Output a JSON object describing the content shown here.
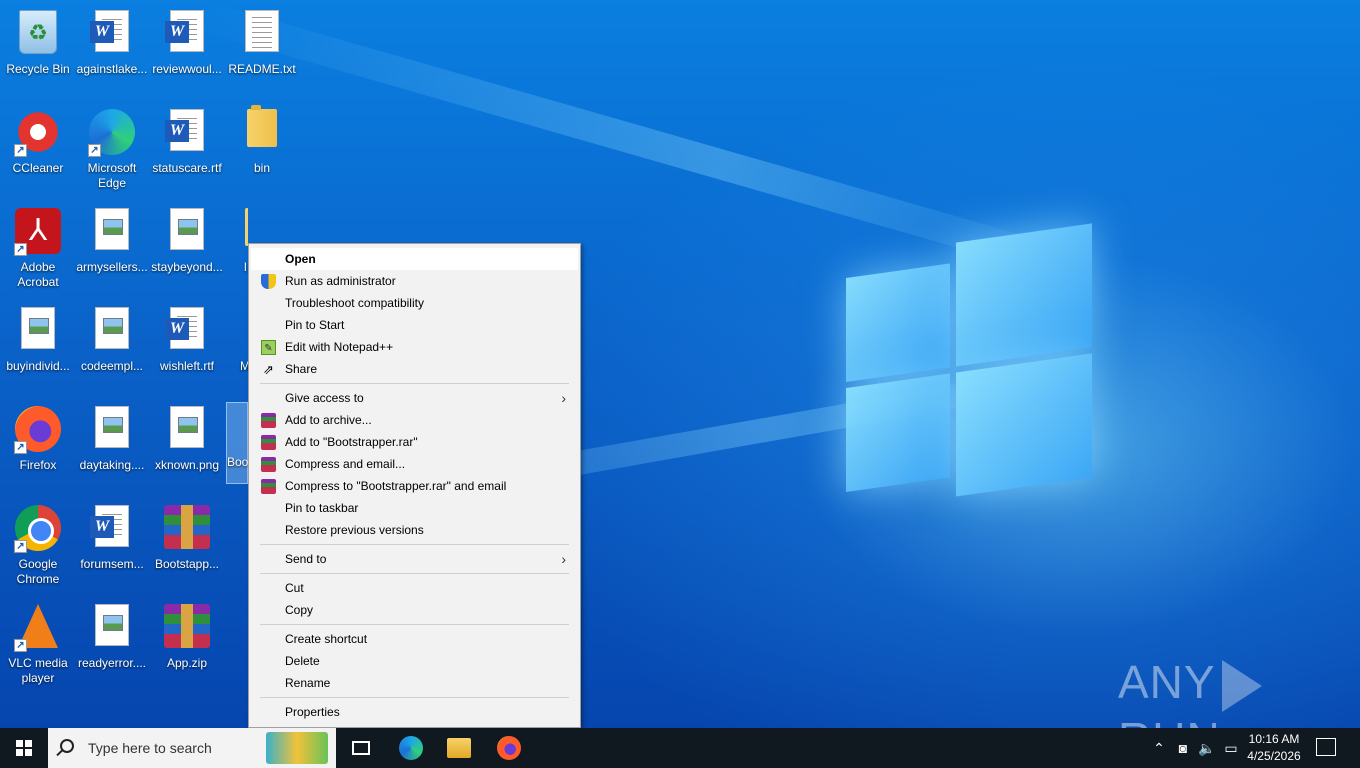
{
  "desktop": {
    "icons": [
      {
        "label": "Recycle Bin",
        "type": "recycle"
      },
      {
        "label": "againstlake...",
        "type": "word"
      },
      {
        "label": "reviewwoul...",
        "type": "word"
      },
      {
        "label": "README.txt",
        "type": "txt"
      },
      {
        "label": "CCleaner",
        "type": "ccleaner"
      },
      {
        "label": "Microsoft Edge",
        "type": "edge"
      },
      {
        "label": "statuscare.rtf",
        "type": "word"
      },
      {
        "label": "bin",
        "type": "folder"
      },
      {
        "label": "Adobe Acrobat",
        "type": "acrobat"
      },
      {
        "label": "armysellers...",
        "type": "image"
      },
      {
        "label": "staybeyond...",
        "type": "image"
      },
      {
        "label": "buyindivid...",
        "type": "image"
      },
      {
        "label": "codeempl...",
        "type": "image"
      },
      {
        "label": "wishleft.rtf",
        "type": "word"
      },
      {
        "label": "Firefox",
        "type": "firefox"
      },
      {
        "label": "daytaking....",
        "type": "image"
      },
      {
        "label": "xknown.png",
        "type": "image"
      },
      {
        "label": "Google Chrome",
        "type": "chrome"
      },
      {
        "label": "forumsem...",
        "type": "word"
      },
      {
        "label": "Bootstapp...",
        "type": "rar"
      },
      {
        "label": "VLC media player",
        "type": "vlc"
      },
      {
        "label": "readyerror....",
        "type": "image"
      },
      {
        "label": "App.zip",
        "type": "rar"
      }
    ],
    "partial_labels": {
      "folder_row3": "l",
      "row4": "M",
      "selected": "Boo"
    }
  },
  "context_menu": {
    "items": [
      {
        "label": "Open",
        "bold": true,
        "icon": ""
      },
      {
        "label": "Run as administrator",
        "icon": "shield-icon"
      },
      {
        "label": "Troubleshoot compatibility",
        "icon": ""
      },
      {
        "label": "Pin to Start",
        "icon": ""
      },
      {
        "label": "Edit with Notepad++",
        "icon": "notepadpp-icon"
      },
      {
        "label": "Share",
        "icon": "share-icon"
      },
      {
        "sep": true
      },
      {
        "label": "Give access to",
        "icon": "",
        "submenu": true
      },
      {
        "label": "Add to archive...",
        "icon": "winrar-icon"
      },
      {
        "label": "Add to \"Bootstrapper.rar\"",
        "icon": "winrar-icon"
      },
      {
        "label": "Compress and email...",
        "icon": "winrar-icon"
      },
      {
        "label": "Compress to \"Bootstrapper.rar\" and email",
        "icon": "winrar-icon"
      },
      {
        "label": "Pin to taskbar",
        "icon": ""
      },
      {
        "label": "Restore previous versions",
        "icon": ""
      },
      {
        "sep": true
      },
      {
        "label": "Send to",
        "icon": "",
        "submenu": true
      },
      {
        "sep": true
      },
      {
        "label": "Cut",
        "icon": ""
      },
      {
        "label": "Copy",
        "icon": ""
      },
      {
        "sep": true
      },
      {
        "label": "Create shortcut",
        "icon": ""
      },
      {
        "label": "Delete",
        "icon": ""
      },
      {
        "label": "Rename",
        "icon": ""
      },
      {
        "sep": true
      },
      {
        "label": "Properties",
        "icon": ""
      }
    ]
  },
  "watermark": {
    "left": "ANY",
    "right": "RUN"
  },
  "taskbar": {
    "search_placeholder": "Type here to search",
    "clock_time": "10:16 AM",
    "clock_date": "4/25/2026"
  },
  "colors": {
    "desktop_blue": "#0a62c9",
    "taskbar": "#101820",
    "menu_bg": "#f2f2f2"
  }
}
